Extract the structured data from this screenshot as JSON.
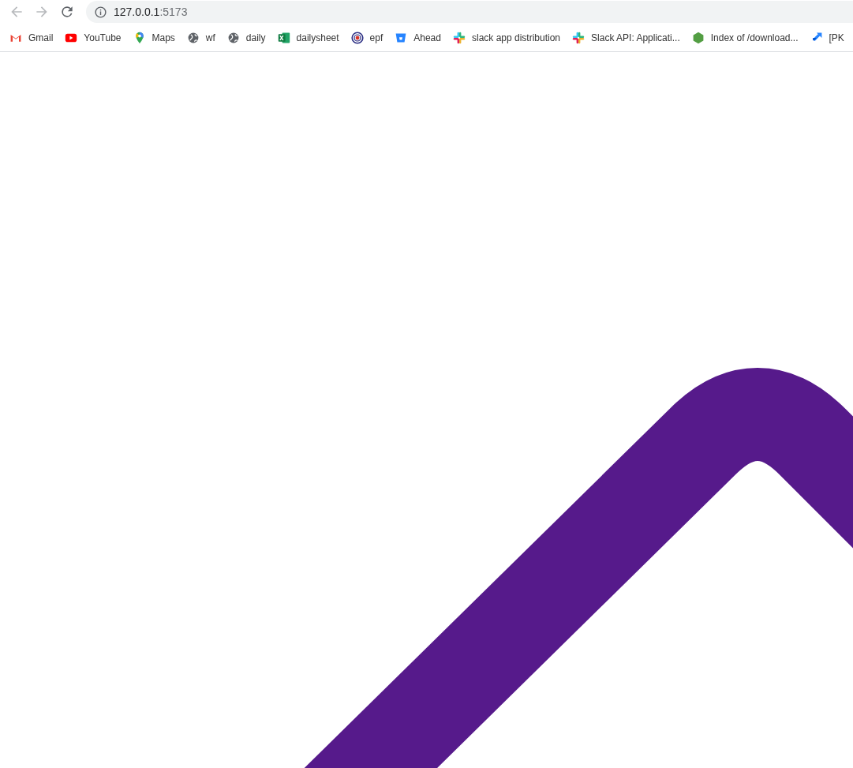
{
  "toolbar": {
    "nav": [
      {
        "kind": "back",
        "disabled": true
      },
      {
        "kind": "forward",
        "disabled": true
      },
      {
        "kind": "reload",
        "disabled": false
      }
    ],
    "address": {
      "host": "127.0.0.1",
      "port": ":5173"
    }
  },
  "bookmarks": [
    {
      "label": "Gmail",
      "kind": "gmail"
    },
    {
      "label": "YouTube",
      "kind": "youtube"
    },
    {
      "label": "Maps",
      "kind": "maps"
    },
    {
      "label": "wf",
      "kind": "globe"
    },
    {
      "label": "daily",
      "kind": "globe"
    },
    {
      "label": "dailysheet",
      "kind": "excel"
    },
    {
      "label": "epf",
      "kind": "emblem"
    },
    {
      "label": "Ahead",
      "kind": "bucket"
    },
    {
      "label": "slack app distribution",
      "kind": "slack"
    },
    {
      "label": "Slack API: Applicati...",
      "kind": "slack"
    },
    {
      "label": "Index of /download...",
      "kind": "hexagon"
    },
    {
      "label": "[PK",
      "kind": "arrows"
    }
  ]
}
